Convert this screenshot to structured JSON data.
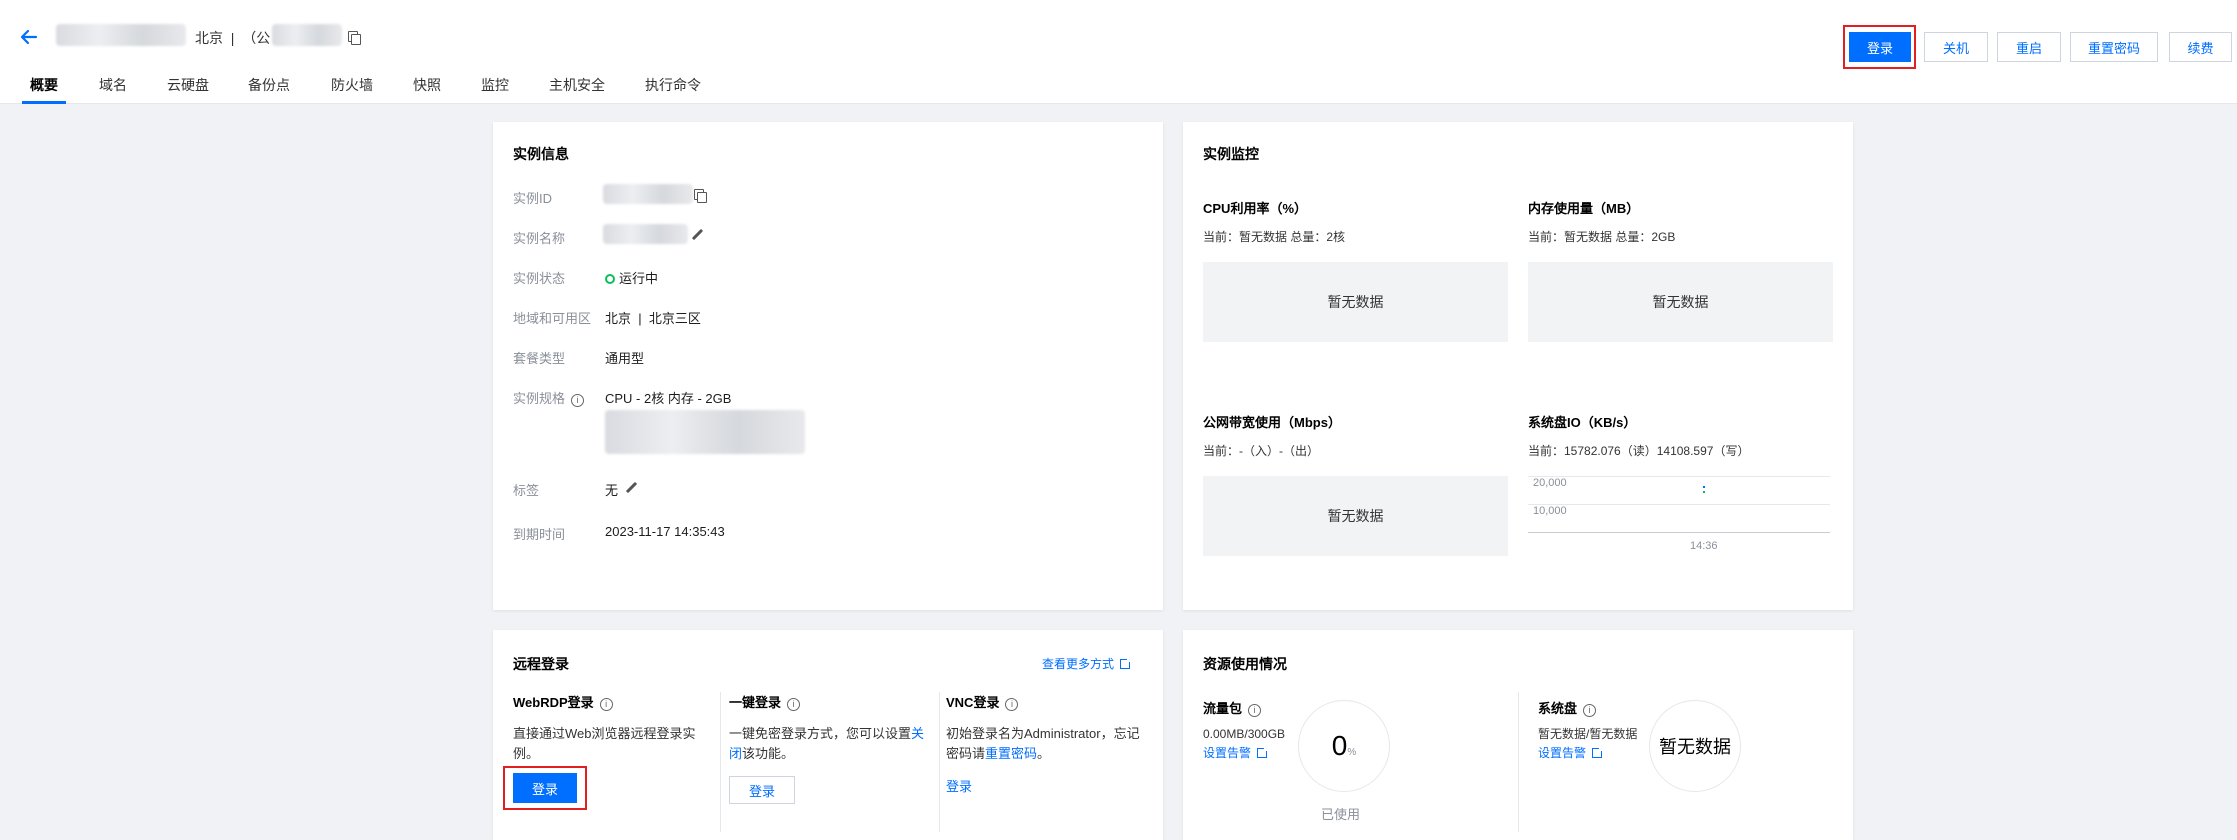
{
  "header": {
    "region": "北京",
    "name_prefix": "（公",
    "buttons": {
      "login": "登录",
      "shutdown": "关机",
      "restart": "重启",
      "reset_pwd": "重置密码",
      "renew": "续费"
    }
  },
  "tabs": [
    "概要",
    "域名",
    "云硬盘",
    "备份点",
    "防火墙",
    "快照",
    "监控",
    "主机安全",
    "执行命令"
  ],
  "instance_info": {
    "title": "实例信息",
    "labels": {
      "id": "实例ID",
      "name": "实例名称",
      "status": "实例状态",
      "region": "地域和可用区",
      "plan": "套餐类型",
      "spec": "实例规格",
      "tags": "标签",
      "expire": "到期时间"
    },
    "values": {
      "status": "运行中",
      "region": "北京",
      "zone": "北京三区",
      "plan": "通用型",
      "spec": "CPU - 2核 内存 - 2GB",
      "tags": "无",
      "expire": "2023-11-17 14:35:43"
    }
  },
  "monitor": {
    "title": "实例监控",
    "cpu": {
      "title": "CPU利用率（%）",
      "sub": "当前：暂无数据 总量：2核",
      "empty": "暂无数据"
    },
    "mem": {
      "title": "内存使用量（MB）",
      "sub": "当前：暂无数据 总量：2GB",
      "empty": "暂无数据"
    },
    "bandwidth": {
      "title": "公网带宽使用（Mbps）",
      "sub": "当前：-（入）-（出）",
      "empty": "暂无数据"
    },
    "disk": {
      "title": "系统盘IO（KB/s）",
      "sub": "当前：15782.076（读）14108.597（写）",
      "y_ticks": [
        "20,000",
        "10,000"
      ],
      "x_tick": "14:36"
    }
  },
  "remote": {
    "title": "远程登录",
    "more": "查看更多方式",
    "webrdp": {
      "title": "WebRDP登录",
      "desc": "直接通过Web浏览器远程登录实例。",
      "button": "登录"
    },
    "onekey": {
      "title": "一键登录",
      "desc_a": "一键免密登录方式，您可以设置",
      "desc_link": "关闭",
      "desc_b": "该功能。",
      "button": "登录"
    },
    "vnc": {
      "title": "VNC登录",
      "desc_a": "初始登录名为Administrator，忘记密码请",
      "desc_link": "重置密码",
      "desc_b": "。",
      "button": "登录"
    }
  },
  "resources": {
    "title": "资源使用情况",
    "traffic": {
      "title": "流量包",
      "value": "0.00MB/300GB",
      "alert": "设置告警",
      "ring_value": "0",
      "ring_unit": "%",
      "ring_caption": "已使用"
    },
    "disk": {
      "title": "系统盘",
      "value": "暂无数据/暂无数据",
      "alert": "设置告警",
      "ring_text": "暂无数据"
    }
  },
  "colors": {
    "primary": "#006eff",
    "success": "#0abf5b",
    "highlight": "#e02020"
  }
}
